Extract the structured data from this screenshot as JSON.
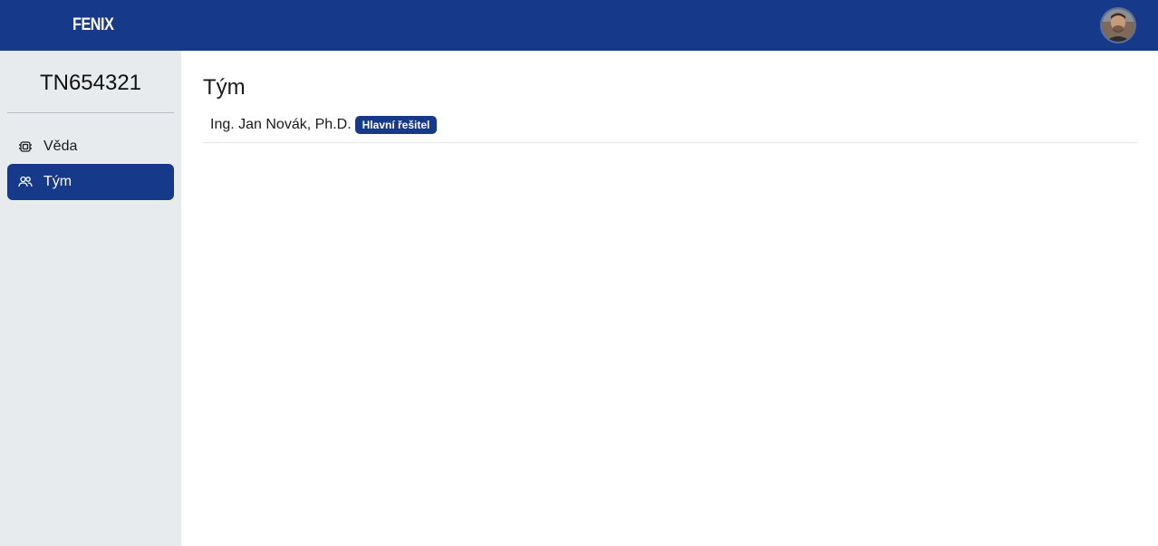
{
  "header": {
    "brand": "FENIX",
    "avatar_icon": "user-avatar"
  },
  "sidebar": {
    "project_id": "TN654321",
    "items": [
      {
        "label": "Věda",
        "icon": "chip-icon",
        "active": false
      },
      {
        "label": "Tým",
        "icon": "users-icon",
        "active": true
      }
    ]
  },
  "main": {
    "title": "Tým",
    "members": [
      {
        "name": "Ing. Jan Novák, Ph.D.",
        "role": "Hlavní řešitel"
      }
    ]
  },
  "colors": {
    "primary": "#163a89",
    "sidebar_bg": "#e8ebee",
    "page_bg": "#ffffff"
  }
}
